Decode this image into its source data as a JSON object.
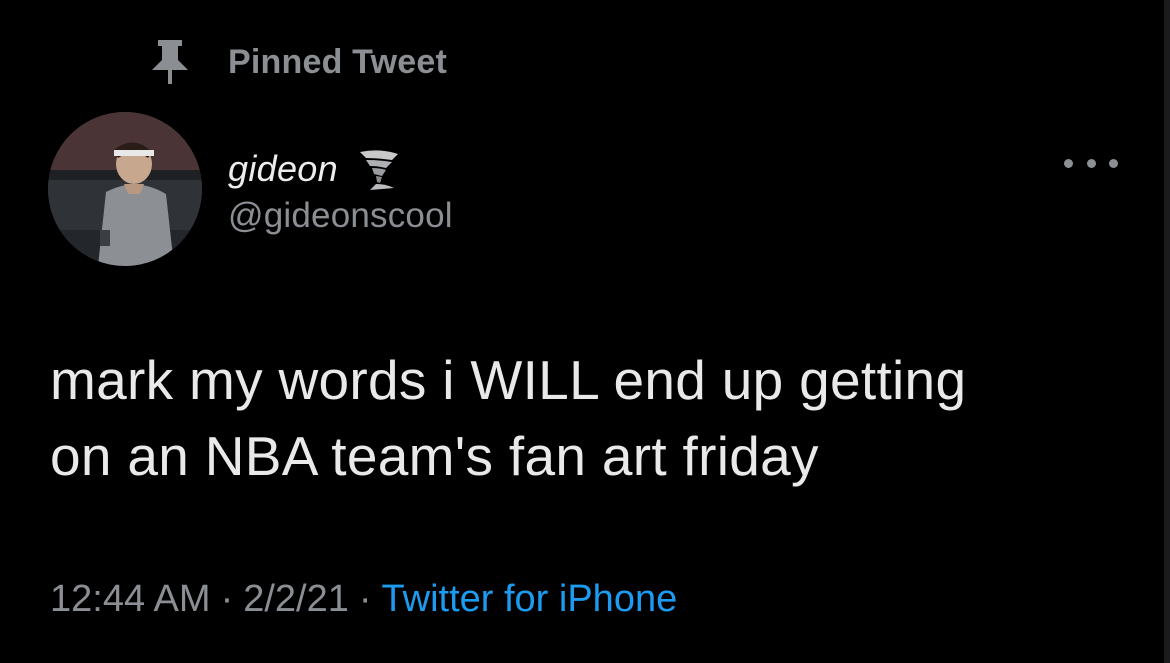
{
  "pinned": {
    "label": "Pinned Tweet",
    "icon": "pin-icon"
  },
  "author": {
    "display_name": "gideon",
    "emoji_icon": "tornado-icon",
    "handle": "@gideonscool",
    "avatar": "avatar-photo"
  },
  "tweet": {
    "text": "mark my words i WILL end up getting\non an NBA team's fan art friday"
  },
  "meta": {
    "time": "12:44 AM",
    "separator": "·",
    "date": "2/2/21",
    "source": "Twitter for iPhone"
  },
  "menu": {
    "icon": "more-options-icon"
  },
  "colors": {
    "background": "#000000",
    "secondary_text": "#8b8f94",
    "primary_text": "#e9e9e9",
    "link": "#1d9bf0"
  }
}
